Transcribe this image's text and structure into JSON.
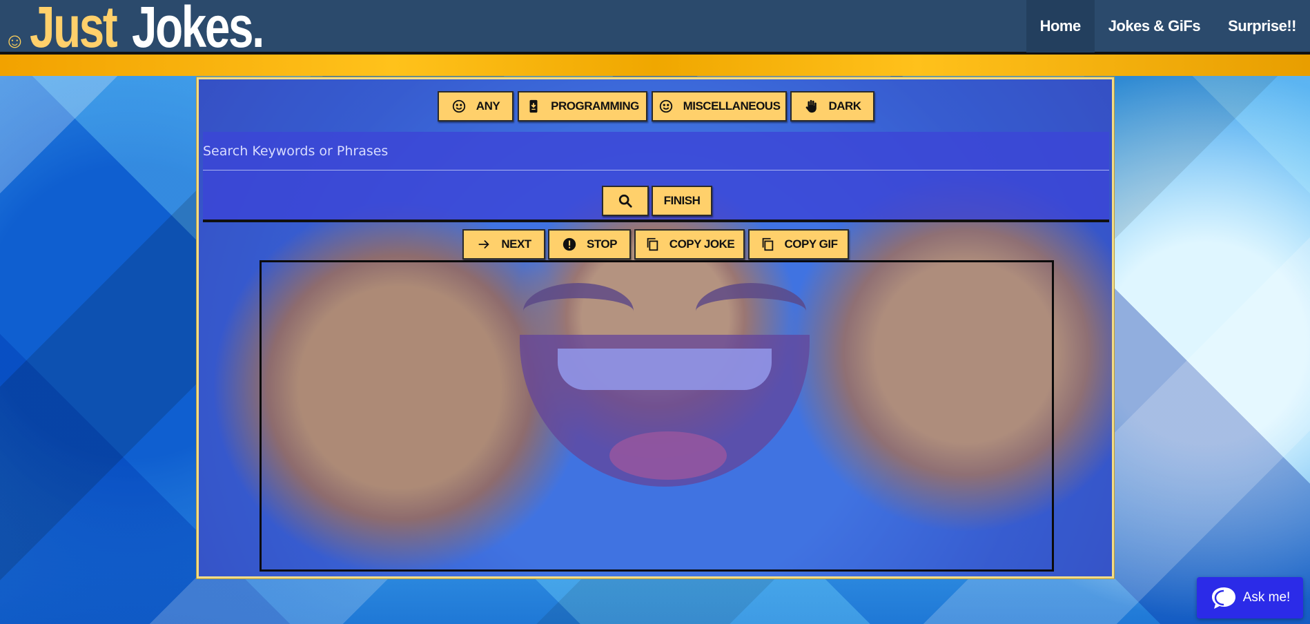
{
  "header": {
    "logo_smile": "☺",
    "logo_just": "Just",
    "logo_jokes": "Jokes.",
    "nav": [
      {
        "label": "Home",
        "active": true
      },
      {
        "label": "Jokes & GiFs",
        "active": false
      },
      {
        "label": "Surprise!!",
        "active": false
      }
    ]
  },
  "categories": {
    "any": "ANY",
    "programming": "PROGRAMMING",
    "miscellaneous": "MISCELLANEOUS",
    "dark": "DARK"
  },
  "search": {
    "placeholder": "Search Keywords or Phrases",
    "value": "",
    "finish_label": "FINISH"
  },
  "controls": {
    "next": "NEXT",
    "stop": "STOP",
    "copy_joke": "COPY JOKE",
    "copy_gif": "COPY GIF"
  },
  "chat": {
    "label": "Ask me!"
  },
  "colors": {
    "header": "#2b4a6c",
    "accent_yellow": "#ffd06b",
    "chat_blue": "#2b2be8"
  }
}
